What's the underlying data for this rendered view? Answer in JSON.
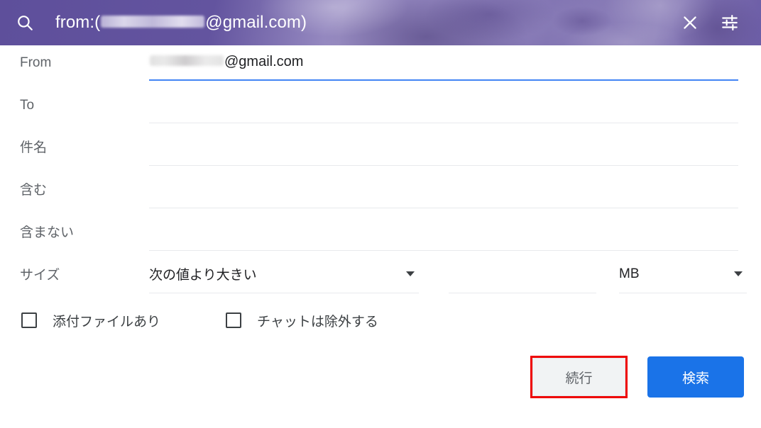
{
  "search_bar": {
    "icon": "search-icon",
    "query_prefix": "from:(",
    "query_redacted": "",
    "query_suffix": "@gmail.com)",
    "close_icon": "close-icon",
    "tune_icon": "tune-icon"
  },
  "form": {
    "fields": [
      {
        "label": "From",
        "value_redacted": "",
        "value_suffix": "@gmail.com",
        "focused": true
      },
      {
        "label": "To",
        "value_redacted": null,
        "value_suffix": "",
        "focused": false
      },
      {
        "label": "件名",
        "value_redacted": null,
        "value_suffix": "",
        "focused": false
      },
      {
        "label": "含む",
        "value_redacted": null,
        "value_suffix": "",
        "focused": false
      },
      {
        "label": "含まない",
        "value_redacted": null,
        "value_suffix": "",
        "focused": false
      }
    ],
    "size": {
      "label": "サイズ",
      "comparator_value": "次の値より大きい",
      "amount_value": "",
      "unit_value": "MB"
    },
    "checkboxes": [
      {
        "label": "添付ファイルあり",
        "checked": false
      },
      {
        "label": "チャットは除外する",
        "checked": false
      }
    ],
    "buttons": {
      "continue_label": "続行",
      "search_label": "検索"
    }
  },
  "colors": {
    "header_purple": "#6354a0",
    "accent_blue": "#1a73e8",
    "focus_underline": "#4285f4",
    "annotation_red": "#ee0000",
    "label_gray": "#5f6368"
  }
}
